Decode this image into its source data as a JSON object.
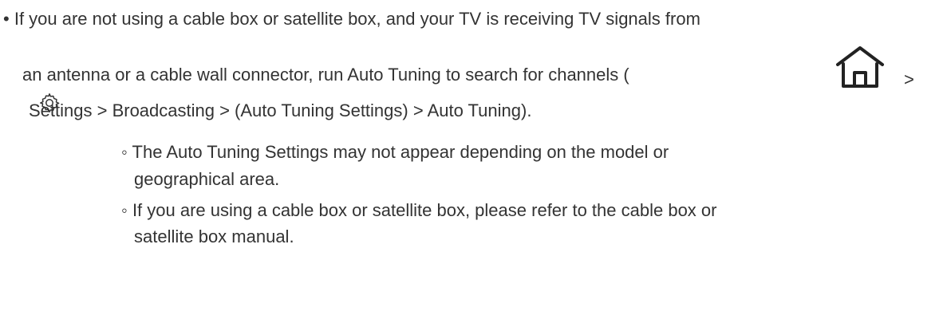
{
  "main": {
    "bullet": "•",
    "sub_bullet": "◦",
    "line1": "If you are not using a cable box or satellite box, and your TV is receiving TV signals from",
    "line2": "an antenna or a cable wall connector, run Auto Tuning to search for channels (",
    "home_suffix": ">",
    "line3": "Settings > Broadcasting > (Auto Tuning Settings) > Auto Tuning).",
    "sub1_line1": "The Auto Tuning Settings may not appear depending on the model or",
    "sub1_line2": "geographical area.",
    "sub2_line1": "If you are using a cable box or satellite box, please refer to the cable box or",
    "sub2_line2": "satellite box manual."
  },
  "icons": {
    "home": "home-icon",
    "settings": "gear-icon"
  }
}
